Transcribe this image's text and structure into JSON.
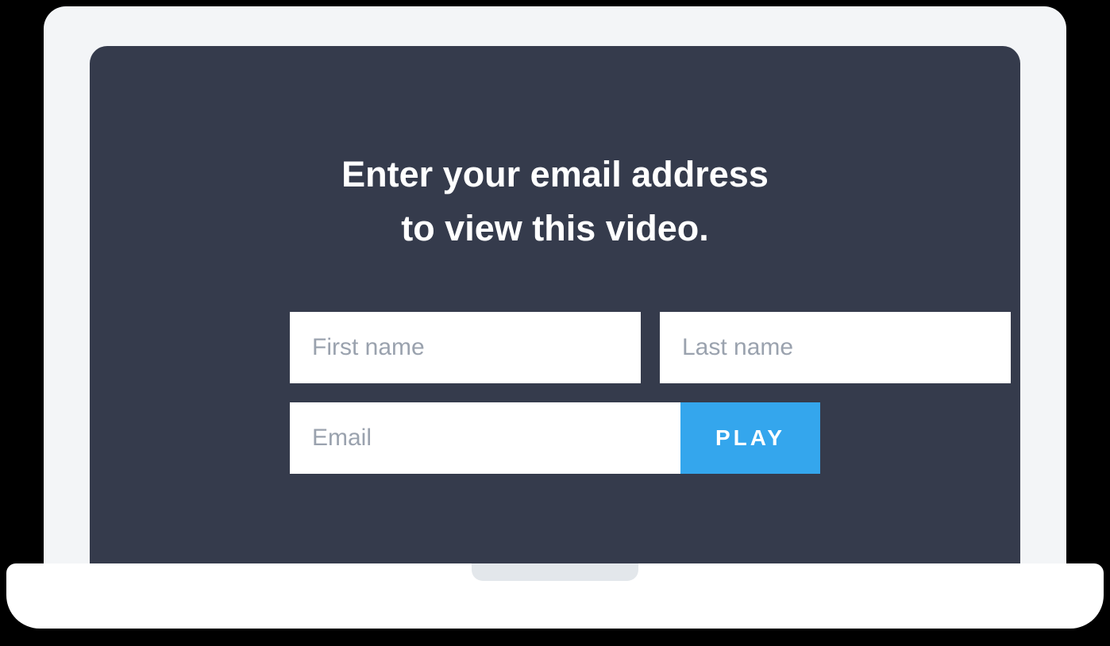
{
  "gate": {
    "heading_line1": "Enter your email address",
    "heading_line2": "to view this video.",
    "first_name_placeholder": "First name",
    "last_name_placeholder": "Last name",
    "email_placeholder": "Email",
    "play_label": "PLAY"
  }
}
